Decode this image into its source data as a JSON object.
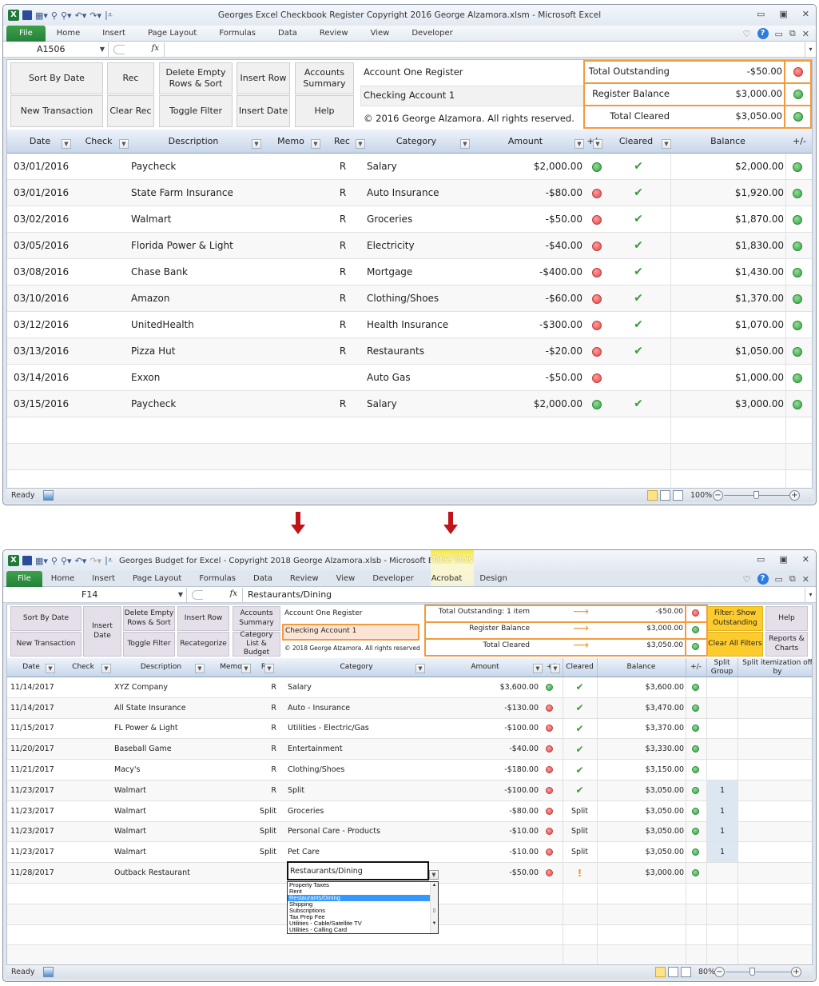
{
  "top": {
    "window_title": "Georges Excel Checkbook Register Copyright 2016 George Alzamora.xlsm  -  Microsoft Excel",
    "ribbon_tabs": [
      "File",
      "Home",
      "Insert",
      "Page Layout",
      "Formulas",
      "Data",
      "Review",
      "View",
      "Developer"
    ],
    "name_box": "A1506",
    "formula": "",
    "buttons": {
      "sort_by_date": "Sort By Date",
      "new_transaction": "New Transaction",
      "rec": "Rec",
      "clear_rec": "Clear Rec",
      "delete_empty": "Delete Empty Rows & Sort",
      "toggle_filter": "Toggle Filter",
      "insert_row": "Insert Row",
      "insert_date": "Insert Date",
      "accounts_summary": "Accounts Summary",
      "help": "Help"
    },
    "register_title": "Account One Register",
    "account_name": "Checking Account 1",
    "copyright": "© 2016 George Alzamora.  All rights reserved.",
    "summary": [
      {
        "label": "Total Outstanding",
        "value": "-$50.00",
        "status": "red"
      },
      {
        "label": "Register Balance",
        "value": "$3,000.00",
        "status": "green"
      },
      {
        "label": "Total Cleared",
        "value": "$3,050.00",
        "status": "green"
      }
    ],
    "columns": [
      "Date",
      "Check",
      "Description",
      "Memo",
      "Rec",
      "Category",
      "Amount",
      "+/",
      "Cleared",
      "Balance",
      "+/-"
    ],
    "rows": [
      {
        "date": "03/01/2016",
        "check": "",
        "desc": "Paycheck",
        "memo": "",
        "rec": "R",
        "category": "Salary",
        "amount": "$2,000.00",
        "amt_status": "green",
        "cleared": true,
        "balance": "$2,000.00",
        "bal_status": "green"
      },
      {
        "date": "03/01/2016",
        "check": "",
        "desc": "State Farm Insurance",
        "memo": "",
        "rec": "R",
        "category": "Auto Insurance",
        "amount": "-$80.00",
        "amt_status": "red",
        "cleared": true,
        "balance": "$1,920.00",
        "bal_status": "green"
      },
      {
        "date": "03/02/2016",
        "check": "",
        "desc": "Walmart",
        "memo": "",
        "rec": "R",
        "category": "Groceries",
        "amount": "-$50.00",
        "amt_status": "red",
        "cleared": true,
        "balance": "$1,870.00",
        "bal_status": "green"
      },
      {
        "date": "03/05/2016",
        "check": "",
        "desc": "Florida Power & Light",
        "memo": "",
        "rec": "R",
        "category": "Electricity",
        "amount": "-$40.00",
        "amt_status": "red",
        "cleared": true,
        "balance": "$1,830.00",
        "bal_status": "green"
      },
      {
        "date": "03/08/2016",
        "check": "",
        "desc": "Chase Bank",
        "memo": "",
        "rec": "R",
        "category": "Mortgage",
        "amount": "-$400.00",
        "amt_status": "red",
        "cleared": true,
        "balance": "$1,430.00",
        "bal_status": "green"
      },
      {
        "date": "03/10/2016",
        "check": "",
        "desc": "Amazon",
        "memo": "",
        "rec": "R",
        "category": "Clothing/Shoes",
        "amount": "-$60.00",
        "amt_status": "red",
        "cleared": true,
        "balance": "$1,370.00",
        "bal_status": "green"
      },
      {
        "date": "03/12/2016",
        "check": "",
        "desc": "UnitedHealth",
        "memo": "",
        "rec": "R",
        "category": "Health Insurance",
        "amount": "-$300.00",
        "amt_status": "red",
        "cleared": true,
        "balance": "$1,070.00",
        "bal_status": "green"
      },
      {
        "date": "03/13/2016",
        "check": "",
        "desc": "Pizza Hut",
        "memo": "",
        "rec": "R",
        "category": "Restaurants",
        "amount": "-$20.00",
        "amt_status": "red",
        "cleared": true,
        "balance": "$1,050.00",
        "bal_status": "green"
      },
      {
        "date": "03/14/2016",
        "check": "",
        "desc": "Exxon",
        "memo": "",
        "rec": "",
        "category": "Auto Gas",
        "amount": "-$50.00",
        "amt_status": "red",
        "cleared": false,
        "balance": "$1,000.00",
        "bal_status": "green"
      },
      {
        "date": "03/15/2016",
        "check": "",
        "desc": "Paycheck",
        "memo": "",
        "rec": "R",
        "category": "Salary",
        "amount": "$2,000.00",
        "amt_status": "green",
        "cleared": true,
        "balance": "$3,000.00",
        "bal_status": "green"
      }
    ],
    "status": {
      "ready": "Ready",
      "zoom": "100%"
    }
  },
  "bottom": {
    "window_title": "Georges Budget for Excel - Copyright 2018 George Alzamora.xlsb  -  Microsoft E...",
    "context_tab_group": "Table Tools",
    "ribbon_tabs": [
      "File",
      "Home",
      "Insert",
      "Page Layout",
      "Formulas",
      "Data",
      "Review",
      "View",
      "Developer",
      "Acrobat",
      "Design"
    ],
    "name_box": "F14",
    "formula": "Restaurants/Dining",
    "buttons": {
      "sort_by_date": "Sort By Date",
      "new_transaction": "New Transaction",
      "insert_date": "Insert Date",
      "delete_empty": "Delete Empty Rows & Sort",
      "toggle_filter": "Toggle Filter",
      "insert_row": "Insert Row",
      "recategorize": "Recategorize",
      "accounts_summary": "Accounts Summary",
      "category_list": "Category List & Budget",
      "filter_outstanding": "Filter: Show Outstanding",
      "clear_filters": "Clear All Filters",
      "help": "Help",
      "reports": "Reports & Charts"
    },
    "register_title": "Account One Register",
    "account_name": "Checking Account 1",
    "copyright": "© 2018 George Alzamora. All rights reserved",
    "summary": [
      {
        "label": "Total Outstanding: 1 item",
        "value": "-$50.00",
        "status": "red"
      },
      {
        "label": "Register Balance",
        "value": "$3,000.00",
        "status": "green"
      },
      {
        "label": "Total Cleared",
        "value": "$3,050.00",
        "status": "green"
      }
    ],
    "columns": [
      "Date",
      "Check",
      "Description",
      "Memo",
      "Rec",
      "Category",
      "Amount",
      "+/-",
      "Cleared",
      "Balance",
      "+/-",
      "Split Group",
      "Split itemization off by"
    ],
    "rows": [
      {
        "date": "11/14/2017",
        "desc": "XYZ Company",
        "rec": "R",
        "category": "Salary",
        "amount": "$3,600.00",
        "amt_status": "green",
        "cleared": "check",
        "balance": "$3,600.00",
        "split_group": ""
      },
      {
        "date": "11/14/2017",
        "desc": "All State Insurance",
        "rec": "R",
        "category": "Auto - Insurance",
        "amount": "-$130.00",
        "amt_status": "red",
        "cleared": "check",
        "balance": "$3,470.00",
        "split_group": ""
      },
      {
        "date": "11/15/2017",
        "desc": "FL Power & Light",
        "rec": "R",
        "category": "Utilities - Electric/Gas",
        "amount": "-$100.00",
        "amt_status": "red",
        "cleared": "check",
        "balance": "$3,370.00",
        "split_group": ""
      },
      {
        "date": "11/20/2017",
        "desc": "Baseball Game",
        "rec": "R",
        "category": "Entertainment",
        "amount": "-$40.00",
        "amt_status": "red",
        "cleared": "check",
        "balance": "$3,330.00",
        "split_group": ""
      },
      {
        "date": "11/21/2017",
        "desc": "Macy's",
        "rec": "R",
        "category": "Clothing/Shoes",
        "amount": "-$180.00",
        "amt_status": "red",
        "cleared": "check",
        "balance": "$3,150.00",
        "split_group": ""
      },
      {
        "date": "11/23/2017",
        "desc": "Walmart",
        "rec": "R",
        "category": "Split",
        "amount": "-$100.00",
        "amt_status": "red",
        "cleared": "check",
        "balance": "$3,050.00",
        "split_group": "1"
      },
      {
        "date": "11/23/2017",
        "desc": "Walmart",
        "rec": "Split",
        "category": "Groceries",
        "amount": "-$80.00",
        "amt_status": "red",
        "cleared": "Split",
        "balance": "$3,050.00",
        "split_group": "1"
      },
      {
        "date": "11/23/2017",
        "desc": "Walmart",
        "rec": "Split",
        "category": "Personal Care - Products",
        "amount": "-$10.00",
        "amt_status": "red",
        "cleared": "Split",
        "balance": "$3,050.00",
        "split_group": "1"
      },
      {
        "date": "11/23/2017",
        "desc": "Walmart",
        "rec": "Split",
        "category": "Pet Care",
        "amount": "-$10.00",
        "amt_status": "red",
        "cleared": "Split",
        "balance": "$3,050.00",
        "split_group": "1"
      },
      {
        "date": "11/28/2017",
        "desc": "Outback Restaurant",
        "rec": "",
        "category": "Restaurants/Dining",
        "amount": "-$50.00",
        "amt_status": "red",
        "cleared": "!",
        "balance": "$3,000.00",
        "split_group": ""
      }
    ],
    "category_dropdown": {
      "options": [
        "Property Taxes",
        "Rent",
        "Restaurants/Dining",
        "Shipping",
        "Subscriptions",
        "Tax Prep Fee",
        "Utilities - Cable/Satellite TV",
        "Utilities - Calling Card"
      ],
      "selected": "Restaurants/Dining"
    },
    "status": {
      "ready": "Ready",
      "zoom": "80%"
    }
  },
  "colors": {
    "accent_orange": "#f29a3c",
    "header_blue": "#c7d6ea",
    "file_green": "#2b8a3e",
    "button_yellow": "#fccc2e",
    "arrow_red": "#c0141a"
  }
}
